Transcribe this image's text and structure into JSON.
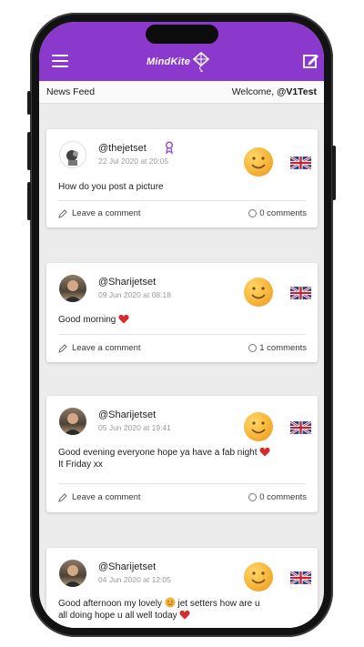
{
  "app": {
    "logo_text": "MindKite"
  },
  "subheader": {
    "section_title": "News Feed",
    "welcome_prefix": "Welcome, ",
    "username": "@V1Test"
  },
  "posts": [
    {
      "username": "@thejetset",
      "date": "22 Jul 2020 at 20:05",
      "message": "How do you post a picture",
      "leave_comment": "Leave a comment",
      "comments": "0 comments"
    },
    {
      "username": "@Sharijetset",
      "date": "09 Jun 2020 at 08:18",
      "message": "Good morning",
      "leave_comment": "Leave a comment",
      "comments": "1 comments"
    },
    {
      "username": "@Sharijetset",
      "date": "05 Jun 2020 at 19:41",
      "message_line1": "Good evening everyone hope ya have a fab night",
      "message_line2": "It Friday xx",
      "leave_comment": "Leave a comment",
      "comments": "0 comments"
    },
    {
      "username": "@Sharijetset",
      "date": "04 Jun 2020 at 12:05",
      "message_line1a": "Good afternoon my lovely",
      "message_line1b": "jet setters how are u",
      "message_line2": "all doing hope u all well today"
    }
  ],
  "colors": {
    "brand": "#8a39cc",
    "heart": "#d62c2c",
    "smiley": "#f7b43a"
  },
  "icons": [
    "menu-icon",
    "logo-kite-icon",
    "compose-icon",
    "verified-badge-icon",
    "smiley-icon",
    "uk-flag-icon",
    "pencil-icon",
    "comment-icon",
    "heart-icon"
  ]
}
